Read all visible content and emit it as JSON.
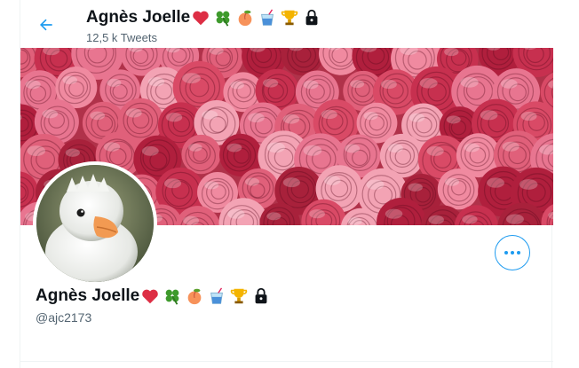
{
  "header": {
    "name": "Agnès Joelle",
    "tweet_count": "12,5 k Tweets"
  },
  "profile": {
    "name": "Agnès Joelle",
    "handle": "@ajc2173",
    "name_emojis": [
      "red-heart",
      "four-leaf-clover",
      "peach",
      "tropical-drink",
      "trophy",
      "locked-padlock"
    ]
  },
  "colors": {
    "accent": "#1d9bf0",
    "secondary_text": "#536471",
    "heart": "#e0245e",
    "banner_rose": "#d9455f"
  }
}
